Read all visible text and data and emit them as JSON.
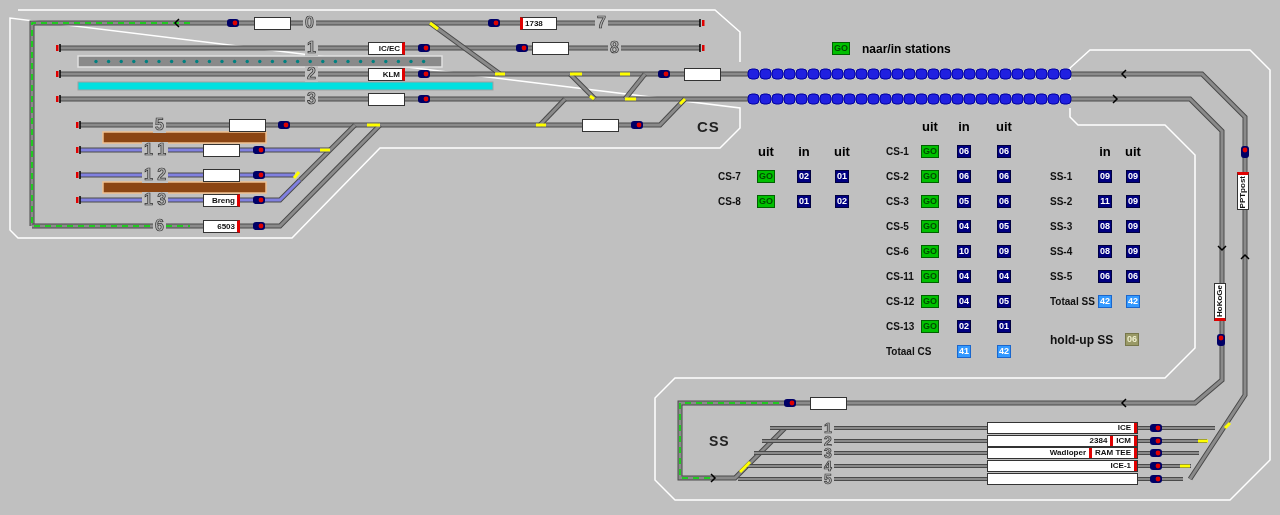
{
  "legend": {
    "badge": {
      "kind": "go",
      "text": "GO"
    },
    "label": "naar/in stations"
  },
  "yards": [
    {
      "name": "CS"
    },
    {
      "name": "SS"
    }
  ],
  "cs_tracks": [
    {
      "number": "0",
      "box": {
        "occupied": false
      }
    },
    {
      "number": "7",
      "box": {
        "occupied": true,
        "text": "1738",
        "marker_left": true
      }
    },
    {
      "number": "1",
      "box": {
        "occupied": true,
        "text": "IC/EC",
        "marker_left": false
      }
    },
    {
      "number": "8",
      "box": {
        "occupied": false
      }
    },
    {
      "number": "2",
      "box": {
        "occupied": true,
        "text": "KLM",
        "marker_left": false
      }
    },
    {
      "number": "3",
      "box": {
        "occupied": false
      }
    },
    {
      "number": "5",
      "box": {
        "occupied": false
      }
    },
    {
      "number": "1 1",
      "box": {
        "occupied": false
      }
    },
    {
      "number": "1 2",
      "box": {
        "occupied": false
      }
    },
    {
      "number": "1 3",
      "box": {
        "occupied": true,
        "text": "Breng",
        "marker_left": false
      }
    },
    {
      "number": "6",
      "box": {
        "occupied": true,
        "text": "6503",
        "marker_left": false
      }
    }
  ],
  "other_boxes": [
    {
      "kind": "horizontal",
      "occupied": false
    },
    {
      "kind": "horizontal",
      "occupied": false
    },
    {
      "kind": "horizontal",
      "occupied": false
    },
    {
      "kind": "vertical",
      "occupied": true,
      "text": "PPTpost",
      "marker_top": true
    },
    {
      "kind": "vertical",
      "occupied": true,
      "text": "HoKoGe",
      "marker_top": false
    }
  ],
  "ss_tracks": [
    {
      "number": "1",
      "trains": [
        {
          "text": "ICE"
        }
      ]
    },
    {
      "number": "2",
      "trains": [
        {
          "text": "2384"
        },
        {
          "text": "ICM"
        }
      ]
    },
    {
      "number": "3",
      "trains": [
        {
          "text": "Wadloper"
        },
        {
          "text": "RAM TEE"
        }
      ]
    },
    {
      "number": "4",
      "trains": [
        {
          "text": "ICE-1"
        }
      ]
    },
    {
      "number": "5"
    }
  ],
  "cs_table_left": {
    "headers": [
      "uit",
      "in",
      "uit"
    ],
    "rows": [
      {
        "label": "CS-7",
        "cells": [
          {
            "kind": "go",
            "text": "GO"
          },
          {
            "kind": "count",
            "text": "02"
          },
          {
            "kind": "count",
            "text": "01"
          }
        ]
      },
      {
        "label": "CS-8",
        "cells": [
          {
            "kind": "go",
            "text": "GO"
          },
          {
            "kind": "count",
            "text": "01"
          },
          {
            "kind": "count",
            "text": "02"
          }
        ]
      }
    ]
  },
  "cs_table_right": {
    "headers": [
      "uit",
      "in",
      "uit"
    ],
    "rows": [
      {
        "label": "CS-1",
        "cells": [
          {
            "kind": "go",
            "text": "GO"
          },
          {
            "kind": "count",
            "text": "06"
          },
          {
            "kind": "count",
            "text": "06"
          }
        ]
      },
      {
        "label": "CS-2",
        "cells": [
          {
            "kind": "go",
            "text": "GO"
          },
          {
            "kind": "count",
            "text": "06"
          },
          {
            "kind": "count",
            "text": "06"
          }
        ]
      },
      {
        "label": "CS-3",
        "cells": [
          {
            "kind": "go",
            "text": "GO"
          },
          {
            "kind": "count",
            "text": "05"
          },
          {
            "kind": "count",
            "text": "06"
          }
        ]
      },
      {
        "label": "CS-5",
        "cells": [
          {
            "kind": "go",
            "text": "GO"
          },
          {
            "kind": "count",
            "text": "04"
          },
          {
            "kind": "count",
            "text": "05"
          }
        ]
      },
      {
        "label": "CS-6",
        "cells": [
          {
            "kind": "go",
            "text": "GO"
          },
          {
            "kind": "count",
            "text": "10"
          },
          {
            "kind": "count",
            "text": "09"
          }
        ]
      },
      {
        "label": "CS-11",
        "cells": [
          {
            "kind": "go",
            "text": "GO"
          },
          {
            "kind": "count",
            "text": "04"
          },
          {
            "kind": "count",
            "text": "04"
          }
        ]
      },
      {
        "label": "CS-12",
        "cells": [
          {
            "kind": "go",
            "text": "GO"
          },
          {
            "kind": "count",
            "text": "04"
          },
          {
            "kind": "count",
            "text": "05"
          }
        ]
      },
      {
        "label": "CS-13",
        "cells": [
          {
            "kind": "go",
            "text": "GO"
          },
          {
            "kind": "count",
            "text": "02"
          },
          {
            "kind": "count",
            "text": "01"
          }
        ]
      },
      {
        "label": "Totaal CS",
        "cells": [
          {
            "kind": "empty",
            "text": ""
          },
          {
            "kind": "total",
            "text": "41"
          },
          {
            "kind": "total",
            "text": "42"
          }
        ]
      }
    ]
  },
  "ss_table": {
    "headers": [
      "in",
      "uit"
    ],
    "rows": [
      {
        "label": "SS-1",
        "cells": [
          {
            "kind": "count",
            "text": "09"
          },
          {
            "kind": "count",
            "text": "09"
          }
        ]
      },
      {
        "label": "SS-2",
        "cells": [
          {
            "kind": "count",
            "text": "11"
          },
          {
            "kind": "count",
            "text": "09"
          }
        ]
      },
      {
        "label": "SS-3",
        "cells": [
          {
            "kind": "count",
            "text": "08"
          },
          {
            "kind": "count",
            "text": "09"
          }
        ]
      },
      {
        "label": "SS-4",
        "cells": [
          {
            "kind": "count",
            "text": "08"
          },
          {
            "kind": "count",
            "text": "09"
          }
        ]
      },
      {
        "label": "SS-5",
        "cells": [
          {
            "kind": "count",
            "text": "06"
          },
          {
            "kind": "count",
            "text": "06"
          }
        ]
      },
      {
        "label": "Totaal SS",
        "cells": [
          {
            "kind": "total",
            "text": "42"
          },
          {
            "kind": "total",
            "text": "42"
          }
        ]
      }
    ]
  },
  "hold_up": {
    "label": "hold-up SS",
    "badge": {
      "kind": "hold",
      "text": "06"
    }
  }
}
